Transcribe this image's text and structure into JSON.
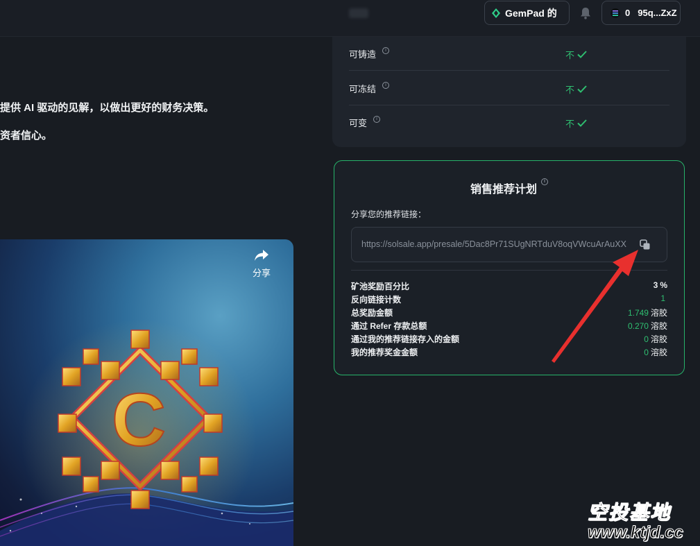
{
  "header": {
    "gempad_label": "GemPad 的",
    "wallet_balance": "0",
    "wallet_address": "95q...ZxZ"
  },
  "project": {
    "desc_line1": "提供 AI 驱动的见解，以做出更好的财务决策。",
    "desc_line2": "资者信心。"
  },
  "video": {
    "share_label": "分享"
  },
  "attributes": [
    {
      "label": "可铸造",
      "value": "不"
    },
    {
      "label": "可冻结",
      "value": "不"
    },
    {
      "label": "可变",
      "value": "不"
    }
  ],
  "referral": {
    "title": "销售推荐计划",
    "share_prompt": "分享您的推荐链接：",
    "link": "https://solsale.app/presale/5Dac8Pr71SUgNRTduV8oqVWcuArAuXX",
    "stats": [
      {
        "label": "矿池奖励百分比",
        "value": "3",
        "unit": "%"
      },
      {
        "label": "反向链接计数",
        "value": "1",
        "unit": ""
      },
      {
        "label": "总奖励金额",
        "value": "1.749",
        "unit": "溶胶"
      },
      {
        "label": "通过 Refer 存款总额",
        "value": "0.270",
        "unit": "溶胶"
      },
      {
        "label": "通过我的推荐链接存入的金额",
        "value": "0",
        "unit": "溶胶"
      },
      {
        "label": "我的推荐奖金金额",
        "value": "0",
        "unit": "溶胶"
      }
    ]
  },
  "watermark": {
    "text_cn": "空投基地",
    "url": "www.ktjd.cc"
  },
  "colors": {
    "accent_green": "#2fbf71",
    "card_border": "#27b46a",
    "arrow_red": "#e8302e",
    "background": "#181c22"
  },
  "icons": [
    "gem-icon",
    "bell-icon",
    "solana-icon",
    "share-icon",
    "info-icon",
    "check-icon",
    "copy-icon"
  ]
}
